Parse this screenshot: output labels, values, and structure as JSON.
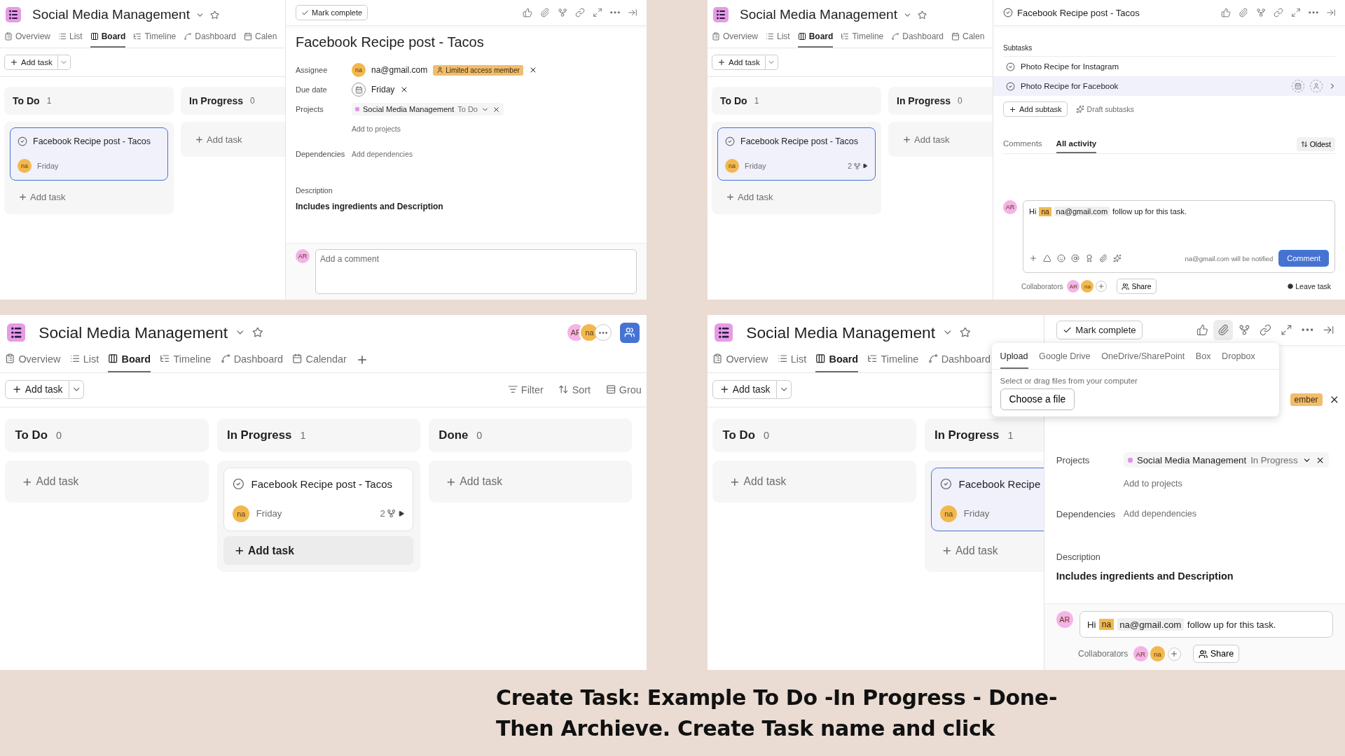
{
  "panels": [
    {
      "title": "Social Media Management",
      "tabs": [
        {
          "kind": "overview",
          "label": "Overview",
          "selected": false
        },
        {
          "kind": "list",
          "label": "List",
          "selected": false
        },
        {
          "kind": "board",
          "label": "Board",
          "selected": true
        },
        {
          "kind": "timeline",
          "label": "Timeline",
          "selected": false
        },
        {
          "kind": "dashboard",
          "label": "Dashboard",
          "selected": false
        },
        {
          "kind": "calendar",
          "label": "Calen",
          "selected": false
        }
      ],
      "add_task": "Add task",
      "columns": [
        {
          "title": "To Do",
          "count": "1",
          "add_task": "Add task",
          "add_task_hovered": false,
          "tasks": [
            {
              "title": "Facebook Recipe post - Tacos",
              "assignee": "na",
              "due": "Friday",
              "selected": true
            }
          ]
        },
        {
          "title": "In Progress",
          "count": "0",
          "add_task": "Add task",
          "add_task_hovered": false
        }
      ],
      "detail": {
        "kind": "fields",
        "mark_complete": "Mark complete",
        "attachment_active": false,
        "title": "Facebook Recipe post - Tacos",
        "fields": [
          {
            "kind": "assignee",
            "label": "Assignee",
            "avatar": "na",
            "value": "na@gmail.com",
            "badge": "Limited access member"
          },
          {
            "kind": "date",
            "label": "Due date",
            "value": "Friday"
          },
          {
            "kind": "project",
            "label": "Projects",
            "value": "Social Media Management",
            "status": "To Do",
            "extra": "Add to projects"
          },
          {
            "kind": "link",
            "label": "Dependencies",
            "value": "Add dependencies"
          }
        ],
        "description_label": "Description",
        "description": "Includes ingredients and Description",
        "comment": {
          "kind": "placeholder",
          "avatar": "AR",
          "placeholder": "Add a comment"
        }
      }
    },
    {
      "title": "Social Media Management",
      "tabs": [
        {
          "kind": "overview",
          "label": "Overview",
          "selected": false
        },
        {
          "kind": "list",
          "label": "List",
          "selected": false
        },
        {
          "kind": "board",
          "label": "Board",
          "selected": true
        },
        {
          "kind": "timeline",
          "label": "Timeline",
          "selected": false
        },
        {
          "kind": "dashboard",
          "label": "Dashboard",
          "selected": false
        },
        {
          "kind": "calendar",
          "label": "Calen",
          "selected": false
        }
      ],
      "add_task": "Add task",
      "columns": [
        {
          "title": "To Do",
          "count": "1",
          "add_task": "Add task",
          "add_task_hovered": false,
          "tasks": [
            {
              "title": "Facebook Recipe post - Tacos",
              "assignee": "na",
              "due": "Friday",
              "subtasks": "2",
              "selected": true
            }
          ]
        },
        {
          "title": "In Progress",
          "count": "0",
          "add_task": "Add task",
          "add_task_hovered": false
        }
      ],
      "detail": {
        "kind": "subtasks",
        "attachment_active": false,
        "title": "Facebook Recipe post - Tacos",
        "subtasks_label": "Subtasks",
        "subtasks": [
          {
            "title": "Photo Recipe for Instagram",
            "hovered": false
          },
          {
            "title": "Photo Recipe for Facebook",
            "hovered": true
          }
        ],
        "add_subtask": "Add subtask",
        "draft_subtasks": "Draft subtasks",
        "activity_tabs": [
          {
            "label": "Comments",
            "selected": false
          },
          {
            "label": "All activity",
            "selected": true
          }
        ],
        "sort": "Oldest",
        "comment": {
          "kind": "mention",
          "avatar": "AR",
          "prefix": "Hi",
          "mention_avatar": "na",
          "mention": "na@gmail.com",
          "suffix": "follow up for this task.",
          "notify": "na@gmail.com will be notified",
          "button": "Comment"
        },
        "collaborators_label": "Collaborators",
        "collaborators": [
          {
            "initials": "AR",
            "color": "#f5b3e6"
          },
          {
            "initials": "na",
            "color": "#f3b84d"
          }
        ],
        "share": "Share",
        "leave": "Leave task"
      }
    },
    {
      "title": "Social Media Management",
      "members": [
        {
          "initials": "AR",
          "color": "#f5b3e6"
        },
        {
          "initials": "na",
          "color": "#f3b84d"
        }
      ],
      "add_view": true,
      "tabs": [
        {
          "kind": "overview",
          "label": "Overview",
          "selected": false
        },
        {
          "kind": "list",
          "label": "List",
          "selected": false
        },
        {
          "kind": "board",
          "label": "Board",
          "selected": true
        },
        {
          "kind": "timeline",
          "label": "Timeline",
          "selected": false
        },
        {
          "kind": "dashboard",
          "label": "Dashboard",
          "selected": false
        },
        {
          "kind": "calendar",
          "label": "Calendar",
          "selected": false
        }
      ],
      "add_task": "Add task",
      "actions": [
        {
          "kind": "filter",
          "label": "Filter"
        },
        {
          "kind": "sort",
          "label": "Sort"
        },
        {
          "kind": "group",
          "label": "Grou"
        }
      ],
      "columns": [
        {
          "title": "To Do",
          "count": "0",
          "add_task": "Add task",
          "add_task_hovered": false
        },
        {
          "title": "In Progress",
          "count": "1",
          "add_task": "Add task",
          "add_task_hovered": true,
          "tasks": [
            {
              "title": "Facebook Recipe post - Tacos",
              "assignee": "na",
              "due": "Friday",
              "subtasks": "2",
              "selected": false
            }
          ]
        },
        {
          "title": "Done",
          "count": "0",
          "add_task": "Add task",
          "add_task_hovered": false
        }
      ]
    },
    {
      "title": "Social Media Management",
      "tabs": [
        {
          "kind": "overview",
          "label": "Overview",
          "selected": false
        },
        {
          "kind": "list",
          "label": "List",
          "selected": false
        },
        {
          "kind": "board",
          "label": "Board",
          "selected": true
        },
        {
          "kind": "timeline",
          "label": "Timeline",
          "selected": false
        },
        {
          "kind": "dashboard",
          "label": "Dashboard",
          "selected": false
        }
      ],
      "add_task": "Add task",
      "columns": [
        {
          "title": "To Do",
          "count": "0",
          "add_task": "Add task",
          "add_task_hovered": false
        },
        {
          "title": "In Progress",
          "count": "1",
          "add_task": "Add task",
          "add_task_hovered": false,
          "tasks": [
            {
              "title": "Facebook Recipe",
              "assignee": "na",
              "due": "Friday",
              "selected": true
            }
          ]
        }
      ],
      "detail": {
        "kind": "fields",
        "mark_complete": "Mark complete",
        "attachment_active": true,
        "fields": [
          {
            "kind": "badge",
            "badge": "ember"
          },
          {
            "kind": "project",
            "label": "Projects",
            "value": "Social Media Management",
            "status": "In Progress",
            "extra": "Add to projects"
          },
          {
            "kind": "link",
            "label": "Dependencies",
            "value": "Add dependencies"
          }
        ],
        "description_label": "Description",
        "description": "Includes ingredients and Description",
        "comment": {
          "kind": "mention_line",
          "avatar": "AR",
          "prefix": "Hi",
          "mention_avatar": "na",
          "mention": "na@gmail.com",
          "suffix": "follow up for this task."
        },
        "collaborators_label": "Collaborators",
        "collaborators": [
          {
            "initials": "AR",
            "color": "#f5b3e6"
          },
          {
            "initials": "na",
            "color": "#f3b84d"
          }
        ],
        "share": "Share",
        "popup": {
          "tabs": [
            {
              "label": "Upload",
              "selected": true
            },
            {
              "label": "Google Drive",
              "selected": false
            },
            {
              "label": "OneDrive/SharePoint",
              "selected": false
            },
            {
              "label": "Box",
              "selected": false
            },
            {
              "label": "Dropbox",
              "selected": false
            }
          ],
          "hint": "Select or drag files from your computer",
          "button": "Choose a file"
        }
      }
    }
  ],
  "caption": [
    "Create Task: Example To Do -In Progress - Done-",
    "Then Archieve. Create Task name and click"
  ]
}
